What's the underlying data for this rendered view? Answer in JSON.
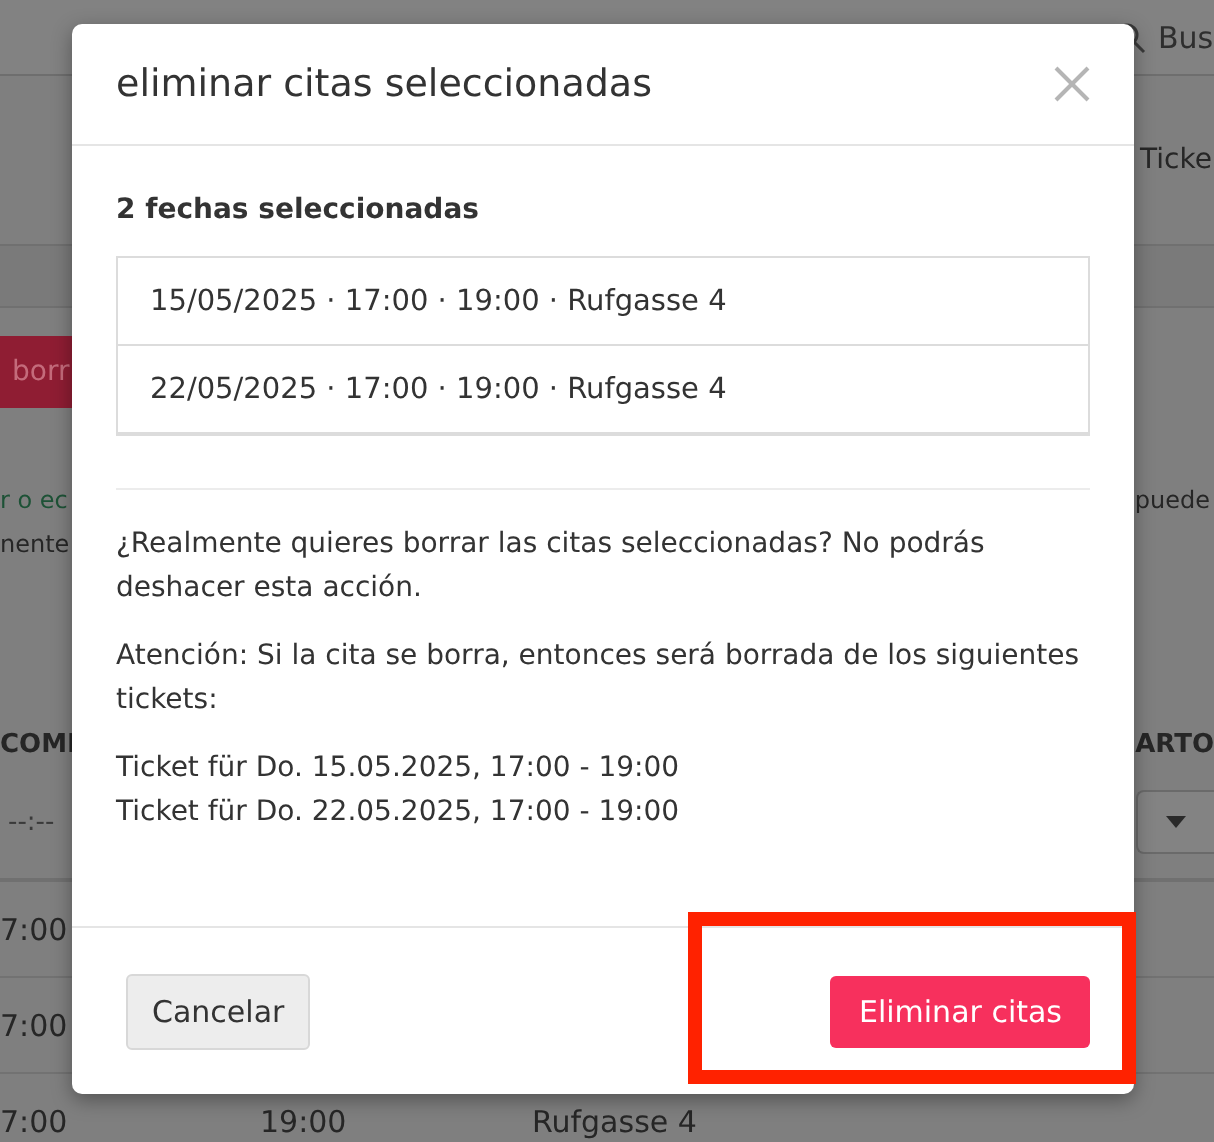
{
  "background_page": {
    "search": {
      "placeholder": "Bus"
    },
    "tab_label": "Ticke",
    "delete_button": "borr",
    "notice_lines": [
      {
        "text": "r o ec",
        "kind": "link"
      },
      {
        "text": "nente",
        "kind": "plain"
      }
    ],
    "notice_right": "puede",
    "table": {
      "columns": [
        {
          "label": "COMI"
        },
        {
          "label": "ARTO"
        }
      ],
      "filter": {
        "time_placeholder": "--:--"
      },
      "rows": [
        {
          "column_1": "7:00"
        },
        {
          "column_1": "7:00"
        },
        {
          "column_1": "7:00",
          "column_2": "19:00",
          "column_3": "Rufgasse 4"
        }
      ]
    }
  },
  "dialog": {
    "title": "eliminar citas seleccionadas",
    "count_label": "2 fechas seleccionadas",
    "appointments": [
      "15/05/2025 · 17:00 · 19:00 · Rufgasse 4",
      "22/05/2025 · 17:00 · 19:00 · Rufgasse 4"
    ],
    "question": "¿Realmente quieres borrar las citas seleccionadas? No podrás deshacer esta acción.",
    "warning": "Atención: Si la cita se borra, entonces será borrada de los siguientes tickets:",
    "tickets": [
      "Ticket für Do. 15.05.2025, 17:00 - 19:00",
      "Ticket für Do. 22.05.2025, 17:00 - 19:00"
    ],
    "buttons": [
      {
        "label": "Cancelar",
        "kind": "secondary",
        "highlighted": false
      },
      {
        "label": "Eliminar citas",
        "kind": "danger",
        "highlighted": true
      }
    ]
  }
}
